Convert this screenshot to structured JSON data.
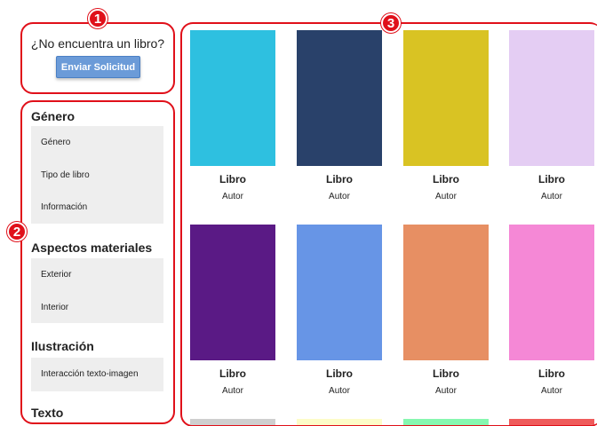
{
  "annotations": [
    "1",
    "2",
    "3"
  ],
  "request": {
    "question": "¿No encuentra un libro?",
    "button_label": "Enviar Solicitud"
  },
  "filters": {
    "genero_heading": "Género",
    "genero_items": [
      "Género",
      "Tipo de libro",
      "Información"
    ],
    "aspectos_heading": "Aspectos materiales",
    "aspectos_items": [
      "Exterior",
      "Interior"
    ],
    "ilustracion_heading": "Ilustración",
    "ilustracion_items": [
      "Interacción texto-imagen"
    ],
    "texto_heading": "Texto"
  },
  "books": [
    {
      "title": "Libro",
      "author": "Autor",
      "color": "#2ec0e0"
    },
    {
      "title": "Libro",
      "author": "Autor",
      "color": "#29416a"
    },
    {
      "title": "Libro",
      "author": "Autor",
      "color": "#d9c323"
    },
    {
      "title": "Libro",
      "author": "Autor",
      "color": "#e4cdf3"
    },
    {
      "title": "Libro",
      "author": "Autor",
      "color": "#5a1a85"
    },
    {
      "title": "Libro",
      "author": "Autor",
      "color": "#6795e6"
    },
    {
      "title": "Libro",
      "author": "Autor",
      "color": "#e78f63"
    },
    {
      "title": "Libro",
      "author": "Autor",
      "color": "#f588d6"
    }
  ],
  "partial_row_colors": [
    "#cfcfcf",
    "#fdfcc8",
    "#86f7b0",
    "#ef5b5b"
  ]
}
